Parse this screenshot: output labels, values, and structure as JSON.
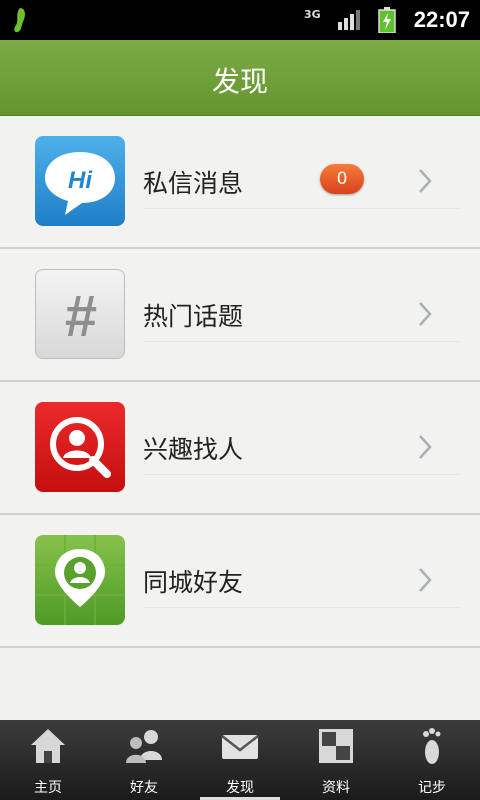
{
  "status_bar": {
    "network": "3G",
    "time": "22:07"
  },
  "header": {
    "title": "发现"
  },
  "list": {
    "items": [
      {
        "label": "私信消息",
        "icon": "hi-chat-icon",
        "badge": "0"
      },
      {
        "label": "热门话题",
        "icon": "hashtag-icon"
      },
      {
        "label": "兴趣找人",
        "icon": "find-person-icon"
      },
      {
        "label": "同城好友",
        "icon": "location-pin-icon"
      }
    ]
  },
  "icon_texts": {
    "hi": "Hi",
    "hash": "#"
  },
  "tabs": [
    {
      "label": "主页",
      "icon": "home-icon"
    },
    {
      "label": "好友",
      "icon": "friends-icon"
    },
    {
      "label": "发现",
      "icon": "envelope-icon",
      "active": true
    },
    {
      "label": "资料",
      "icon": "profile-grid-icon"
    },
    {
      "label": "记步",
      "icon": "footprint-icon"
    }
  ],
  "colors": {
    "header_green": "#6e9f39",
    "badge_orange": "#e8582a",
    "tabbar": "#2b2b2b"
  }
}
